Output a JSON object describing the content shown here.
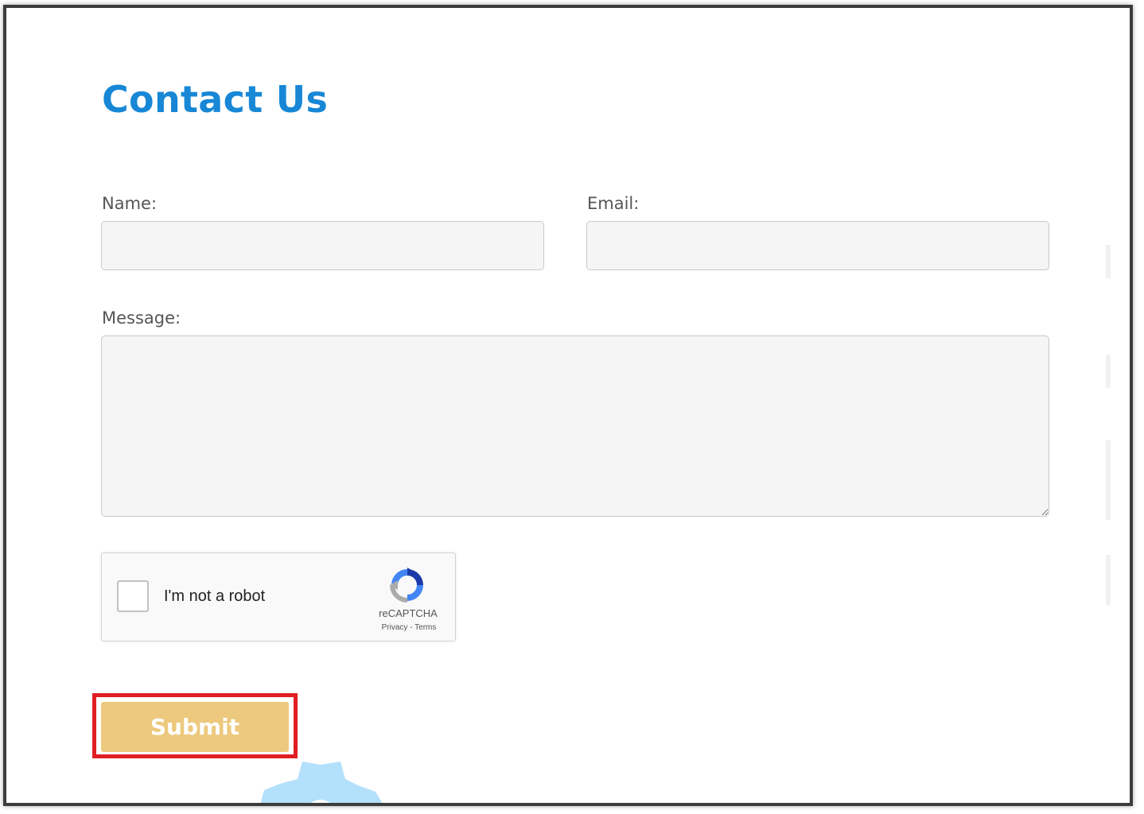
{
  "page": {
    "title": "Contact Us"
  },
  "form": {
    "name_label": "Name:",
    "name_value": "",
    "email_label": "Email:",
    "email_value": "",
    "message_label": "Message:",
    "message_value": "",
    "submit_label": "Submit"
  },
  "recaptcha": {
    "checkbox_label": "I'm not a robot",
    "brand": "reCAPTCHA",
    "privacy_link": "Privacy",
    "separator": "-",
    "terms_link": "Terms",
    "checked": false
  },
  "colors": {
    "title": "#1787d6",
    "submit_bg": "#ecc97d",
    "highlight_border": "#e01e23",
    "field_bg": "#f5f5f5",
    "gear_decoration": "#b3e0fb"
  },
  "icons": {
    "recaptcha_logo": "recaptcha-logo-icon",
    "resize_handle": "resize-handle-icon",
    "decoration": "gear-icon"
  }
}
